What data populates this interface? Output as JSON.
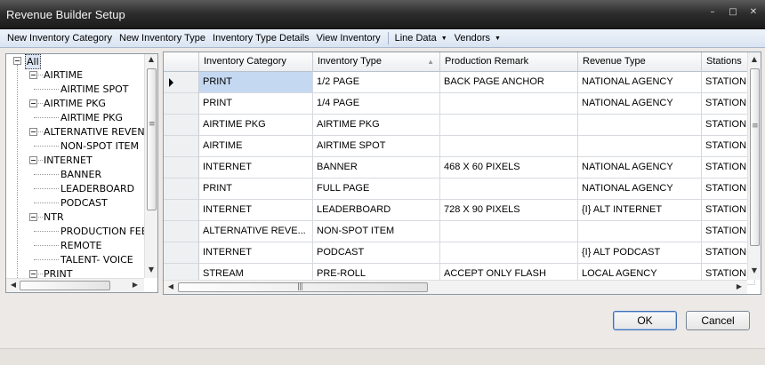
{
  "window": {
    "title": "Revenue Builder Setup",
    "minimize_glyph": "–",
    "maximize_glyph": "□",
    "close_glyph": "✕"
  },
  "menu": {
    "items": [
      {
        "label": "New Inventory Category",
        "dropdown": false
      },
      {
        "label": "New Inventory Type",
        "dropdown": false
      },
      {
        "label": "Inventory Type Details",
        "dropdown": false
      },
      {
        "label": "View Inventory",
        "dropdown": false
      },
      {
        "label": "Line Data",
        "dropdown": true
      },
      {
        "label": "Vendors",
        "dropdown": true
      }
    ],
    "dropdown_glyph": "▼"
  },
  "tree": {
    "nodes": [
      {
        "label": "All",
        "level": 0,
        "expanded": true,
        "selected": true
      },
      {
        "label": "AIRTIME",
        "level": 1,
        "expanded": true
      },
      {
        "label": "AIRTIME SPOT",
        "level": 2
      },
      {
        "label": "AIRTIME PKG",
        "level": 1,
        "expanded": true
      },
      {
        "label": "AIRTIME PKG",
        "level": 2
      },
      {
        "label": "ALTERNATIVE REVEN",
        "level": 1,
        "expanded": true
      },
      {
        "label": "NON-SPOT ITEM",
        "level": 2
      },
      {
        "label": "INTERNET",
        "level": 1,
        "expanded": true
      },
      {
        "label": "BANNER",
        "level": 2
      },
      {
        "label": "LEADERBOARD",
        "level": 2
      },
      {
        "label": "PODCAST",
        "level": 2
      },
      {
        "label": "NTR",
        "level": 1,
        "expanded": true
      },
      {
        "label": "PRODUCTION FEE",
        "level": 2
      },
      {
        "label": "REMOTE",
        "level": 2
      },
      {
        "label": "TALENT- VOICE",
        "level": 2
      },
      {
        "label": "PRINT",
        "level": 1,
        "expanded": true
      }
    ]
  },
  "grid": {
    "columns": [
      "Inventory Category",
      "Inventory Type",
      "Production Remark",
      "Revenue Type",
      "Stations"
    ],
    "sort_glyph": "▲",
    "rows": [
      [
        "PRINT",
        "1/2 PAGE",
        "BACK PAGE ANCHOR",
        "NATIONAL AGENCY",
        "STATION"
      ],
      [
        "PRINT",
        "1/4 PAGE",
        "",
        "NATIONAL AGENCY",
        "STATION"
      ],
      [
        "AIRTIME PKG",
        "AIRTIME PKG",
        "",
        "",
        "STATION"
      ],
      [
        "AIRTIME",
        "AIRTIME SPOT",
        "",
        "",
        "STATION"
      ],
      [
        "INTERNET",
        "BANNER",
        "468 X 60 PIXELS",
        "NATIONAL AGENCY",
        "STATION"
      ],
      [
        "PRINT",
        "FULL PAGE",
        "",
        "NATIONAL AGENCY",
        "STATION"
      ],
      [
        "INTERNET",
        "LEADERBOARD",
        "728 X 90 PIXELS",
        "{I} ALT INTERNET",
        "STATION"
      ],
      [
        "ALTERNATIVE REVE...",
        "NON-SPOT ITEM",
        "",
        "",
        "STATION"
      ],
      [
        "INTERNET",
        "PODCAST",
        "",
        "{I} ALT PODCAST",
        "STATION"
      ],
      [
        "STREAM",
        "PRE-ROLL",
        "ACCEPT ONLY FLASH",
        "LOCAL AGENCY",
        "STATION"
      ]
    ],
    "active_row": 0
  },
  "buttons": {
    "ok": "OK",
    "cancel": "Cancel"
  },
  "scroll_glyphs": {
    "up": "▲",
    "down": "▼",
    "left": "◀",
    "right": "▶",
    "grip": "≡",
    "hgrip": "|||"
  },
  "colors": {
    "title_bar": "#2e2e2e",
    "selected_cell": "#c5d8f1",
    "default_button_border": "#3d6fb6"
  }
}
